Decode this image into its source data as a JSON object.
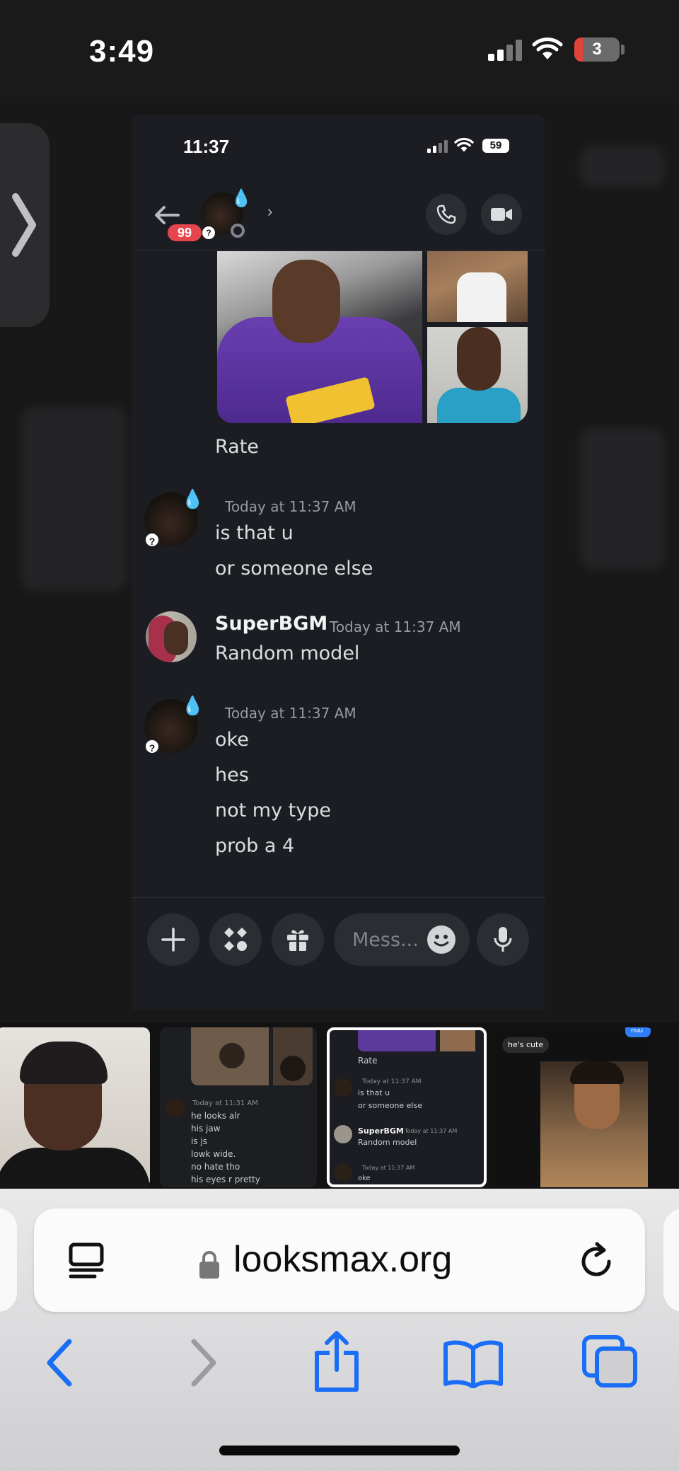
{
  "outer_status": {
    "time": "3:49",
    "battery": "3"
  },
  "inner_status": {
    "time": "11:37",
    "battery": "59"
  },
  "chat_header": {
    "badge_count": "99"
  },
  "messages": [
    {
      "text": "Rate"
    },
    {
      "timestamp": "Today at 11:37 AM",
      "lines": [
        "is that u",
        "or someone else"
      ]
    },
    {
      "username": "SuperBGM",
      "timestamp": "Today at 11:37 AM",
      "lines": [
        "Random model"
      ]
    },
    {
      "timestamp": "Today at 11:37 AM",
      "lines": [
        "oke",
        "hes",
        "not my type",
        "prob a 4"
      ]
    }
  ],
  "composer": {
    "placeholder": "Mess..."
  },
  "tabs": {
    "tab2": {
      "timestamp": "Today at 11:31 AM",
      "lines": [
        "he looks alr",
        "his jaw",
        "is js",
        "lowk wide.",
        "no hate tho",
        "his eyes r pretty"
      ]
    },
    "tab3": {
      "text": "Rate",
      "timestamp1": "Today at 11:37 AM",
      "lines1": [
        "is that u",
        "or someone else"
      ],
      "username": "SuperBGM",
      "timestamp2": "Today at 11:37 AM",
      "line2": "Random model",
      "timestamp3": "Today at 11:37 AM",
      "line3": "oke"
    },
    "tab4": {
      "bubble": "he's cute",
      "blue_bubble": "nuu"
    }
  },
  "safari": {
    "url": "looksmax.org"
  },
  "colors": {
    "accent_blue": "#1a6ef5",
    "badge_red": "#e5454c",
    "discord_bg": "#1c1d22"
  }
}
